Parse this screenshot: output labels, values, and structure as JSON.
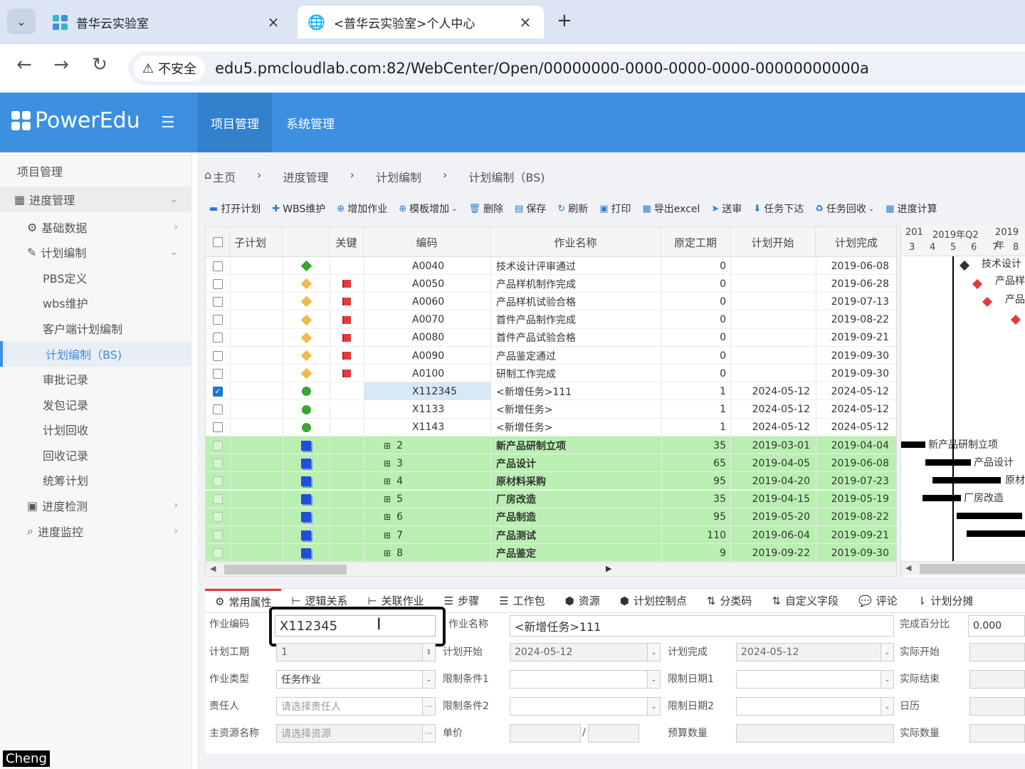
{
  "browser": {
    "tabs": [
      {
        "title": "普华云实验室",
        "close": "×"
      },
      {
        "title": "<普华云实验室>个人中心",
        "close": "×"
      }
    ],
    "new_tab": "+",
    "tab_menu": "⌄",
    "security_label": "不安全",
    "url": "edu5.pmcloudlab.com:82/WebCenter/Open/00000000-0000-0000-0000-00000000000a"
  },
  "app": {
    "logo": "PowerEdu",
    "nav": [
      "项目管理",
      "系统管理"
    ]
  },
  "sidebar": {
    "items": [
      {
        "label": "项目管理"
      },
      {
        "label": "进度管理",
        "chev": "⌄"
      },
      {
        "label": "基础数据",
        "chev": "›"
      },
      {
        "label": "计划编制",
        "chev": "⌄"
      },
      {
        "label": "PBS定义"
      },
      {
        "label": "wbs维护"
      },
      {
        "label": "客户端计划编制"
      },
      {
        "label": "计划编制（BS)"
      },
      {
        "label": "审批记录"
      },
      {
        "label": "发包记录"
      },
      {
        "label": "计划回收"
      },
      {
        "label": "回收记录"
      },
      {
        "label": "统筹计划"
      },
      {
        "label": "进度检测",
        "chev": "›"
      },
      {
        "label": "进度监控",
        "chev": "›"
      }
    ]
  },
  "breadcrumb": [
    "主页",
    "›",
    "进度管理",
    "›",
    "计划编制",
    "›",
    "计划编制（BS)"
  ],
  "toolbar": [
    "打开计划",
    "WBS维护",
    "增加作业",
    "模板增加",
    "删除",
    "保存",
    "刷新",
    "打印",
    "导出excel",
    "送审",
    "任务下达",
    "任务回收",
    "进度计算"
  ],
  "grid": {
    "columns": [
      "子计划",
      "关键",
      "编码",
      "作业名称",
      "原定工期",
      "计划开始",
      "计划完成"
    ],
    "rows": [
      {
        "code": "A0040",
        "name": "技术设计评审通过",
        "dur": "0",
        "start": "",
        "finish": "2019-06-08"
      },
      {
        "code": "A0050",
        "name": "产品样机制作完成",
        "dur": "0",
        "start": "",
        "finish": "2019-06-28"
      },
      {
        "code": "A0060",
        "name": "产品样机试验合格",
        "dur": "0",
        "start": "",
        "finish": "2019-07-13"
      },
      {
        "code": "A0070",
        "name": "首件产品制作完成",
        "dur": "0",
        "start": "",
        "finish": "2019-08-22"
      },
      {
        "code": "A0080",
        "name": "首件产品试验合格",
        "dur": "0",
        "start": "",
        "finish": "2019-09-21"
      },
      {
        "code": "A0090",
        "name": "产品鉴定通过",
        "dur": "0",
        "start": "",
        "finish": "2019-09-30"
      },
      {
        "code": "A0100",
        "name": "研制工作完成",
        "dur": "0",
        "start": "",
        "finish": "2019-09-30"
      },
      {
        "code": "X112345",
        "name": "<新增任务>111",
        "dur": "1",
        "start": "2024-05-12",
        "finish": "2024-05-12"
      },
      {
        "code": "X1133",
        "name": "<新增任务>",
        "dur": "1",
        "start": "2024-05-12",
        "finish": "2024-05-12"
      },
      {
        "code": "X1143",
        "name": "<新增任务>",
        "dur": "1",
        "start": "2024-05-12",
        "finish": "2024-05-12"
      },
      {
        "code": "2",
        "name": "新产品研制立项",
        "dur": "35",
        "start": "2019-03-01",
        "finish": "2019-04-04"
      },
      {
        "code": "3",
        "name": "产品设计",
        "dur": "65",
        "start": "2019-04-05",
        "finish": "2019-06-08"
      },
      {
        "code": "4",
        "name": "原材料采购",
        "dur": "95",
        "start": "2019-04-20",
        "finish": "2019-07-23"
      },
      {
        "code": "5",
        "name": "厂房改造",
        "dur": "35",
        "start": "2019-04-15",
        "finish": "2019-05-19"
      },
      {
        "code": "6",
        "name": "产品制造",
        "dur": "95",
        "start": "2019-05-20",
        "finish": "2019-08-22"
      },
      {
        "code": "7",
        "name": "产品测试",
        "dur": "110",
        "start": "2019-06-04",
        "finish": "2019-09-21"
      },
      {
        "code": "8",
        "name": "产品鉴定",
        "dur": "9",
        "start": "2019-09-22",
        "finish": "2019-09-30"
      }
    ]
  },
  "gantt": {
    "header_top": [
      "201",
      "2019年Q2",
      "2019年"
    ],
    "header_months": [
      "3",
      "4",
      "5",
      "6",
      "7",
      "8"
    ],
    "labels": [
      "技术设计",
      "产品样",
      "产品",
      "新产品研制立项",
      "产品设计",
      "原材",
      "厂房改造"
    ]
  },
  "bottom_tabs": [
    "常用属性",
    "逻辑关系",
    "关联作业",
    "步骤",
    "工作包",
    "资源",
    "计划控制点",
    "分类码",
    "自定义字段",
    "评论",
    "计划分摊"
  ],
  "form": {
    "code_label": "作业编码",
    "code_value": "X112345",
    "name_label": "作业名称",
    "name_value": "<新增任务>111",
    "pct_label": "完成百分比",
    "pct_value": "0.000",
    "dur_label": "计划工期",
    "dur_value": "1",
    "start_label": "计划开始",
    "start_value": "2024-05-12",
    "finish_label": "计划完成",
    "finish_value": "2024-05-12",
    "actual_start_label": "实际开始",
    "type_label": "作业类型",
    "type_value": "任务作业",
    "cond1_label": "限制条件1",
    "date1_label": "限制日期1",
    "actual_end_label": "实际结束",
    "owner_label": "责任人",
    "owner_placeholder": "请选择责任人",
    "cond2_label": "限制条件2",
    "date2_label": "限制日期2",
    "calendar_label": "日历",
    "resource_label": "主资源名称",
    "resource_placeholder": "请选择资源",
    "price_label": "单价",
    "price_sep": "/",
    "budget_label": "预算数量",
    "actual_qty_label": "实际数量"
  },
  "watermark": "Cheng"
}
